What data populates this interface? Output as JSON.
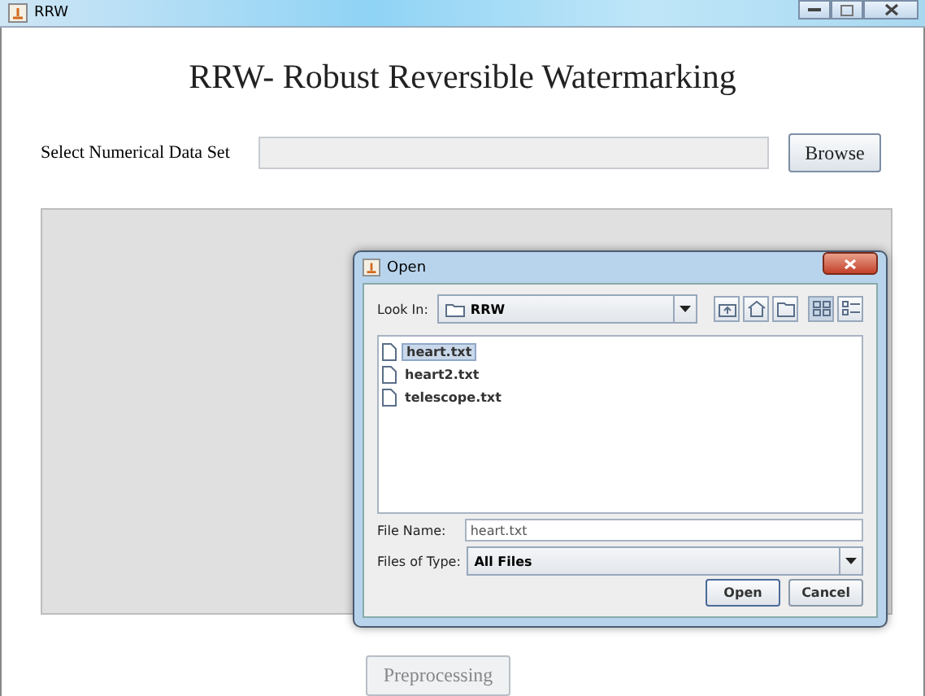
{
  "window": {
    "title": "RRW"
  },
  "heading": "RRW- Robust Reversible Watermarking",
  "dataset": {
    "label": "Select Numerical Data Set",
    "browse": "Browse"
  },
  "preprocessing": {
    "label": "Preprocessing",
    "disabled": true
  },
  "dialog": {
    "title": "Open",
    "look_in_label": "Look In:",
    "look_in_value": "RRW",
    "files": [
      {
        "name": "heart.txt",
        "selected": true
      },
      {
        "name": "heart2.txt",
        "selected": false
      },
      {
        "name": "telescope.txt",
        "selected": false
      }
    ],
    "file_name_label": "File Name:",
    "file_name_value": "heart.txt",
    "file_type_label": "Files of Type:",
    "file_type_value": "All Files",
    "buttons": [
      "Open",
      "Cancel"
    ]
  }
}
